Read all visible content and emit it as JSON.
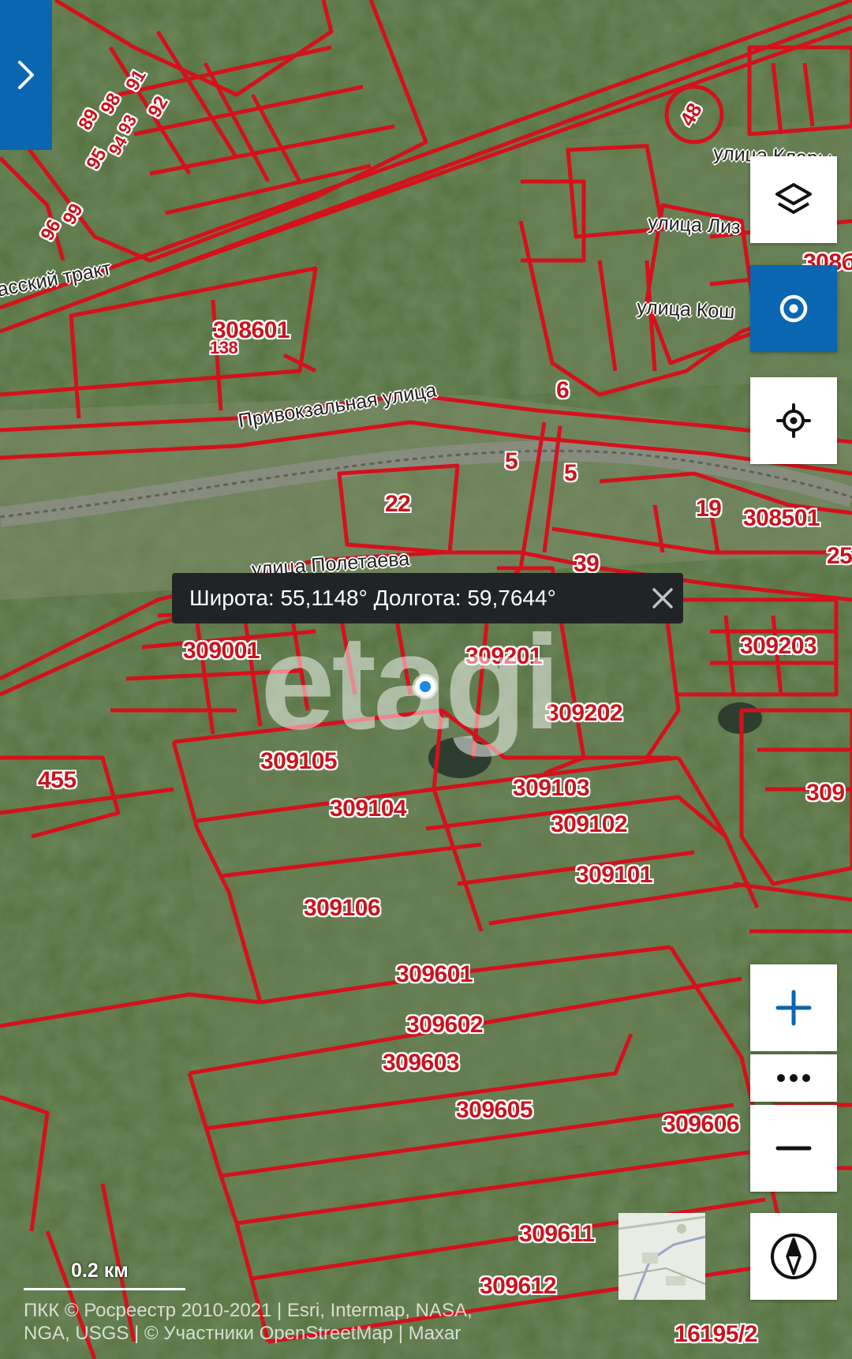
{
  "colors": {
    "accent": "#0a66b0",
    "parcel_line": "#d4111c",
    "tooltip_bg": "#202426"
  },
  "streets": [
    {
      "id": "trakt",
      "text": "асский тракт"
    },
    {
      "id": "privokzalnaya",
      "text": "Привокзальная улица"
    },
    {
      "id": "poletaeva",
      "text": "улица Полетаева"
    },
    {
      "id": "klary",
      "text": "улица Клары"
    },
    {
      "id": "lizy",
      "text": "улица Лиз"
    },
    {
      "id": "kosh",
      "text": "улица Кош"
    }
  ],
  "parcels": [
    "308601",
    "22",
    "6",
    "5",
    "5",
    "19",
    "308501",
    "39",
    "25",
    "309001",
    "309201",
    "309203",
    "309202",
    "309105",
    "309103",
    "455",
    "309104",
    "309102",
    "309101",
    "309106",
    "309601",
    "309602",
    "309603",
    "309605",
    "309606",
    "309611",
    "309612",
    "16195/2",
    "48",
    "308б",
    "309",
    "138",
    "91",
    "92",
    "98",
    "89",
    "95",
    "96",
    "99",
    "93",
    "94"
  ],
  "coordinates": {
    "text": "Широта: 55,1148° Долгота: 59,7644°"
  },
  "watermark": "etagi",
  "scale": {
    "label": "0.2 км"
  },
  "attribution": {
    "line1": "ПКК © Росреестр 2010-2021 | Esri, Intermap, NASA,",
    "line2": "NGA, USGS | © Участники OpenStreetMap | Maxar"
  },
  "controls": {
    "layers": "layers-icon",
    "locate": "target-icon",
    "position": "crosshair-icon",
    "zoom_in": "plus-icon",
    "more": "more-icon",
    "zoom_out": "minus-icon",
    "compass": "compass-icon"
  }
}
